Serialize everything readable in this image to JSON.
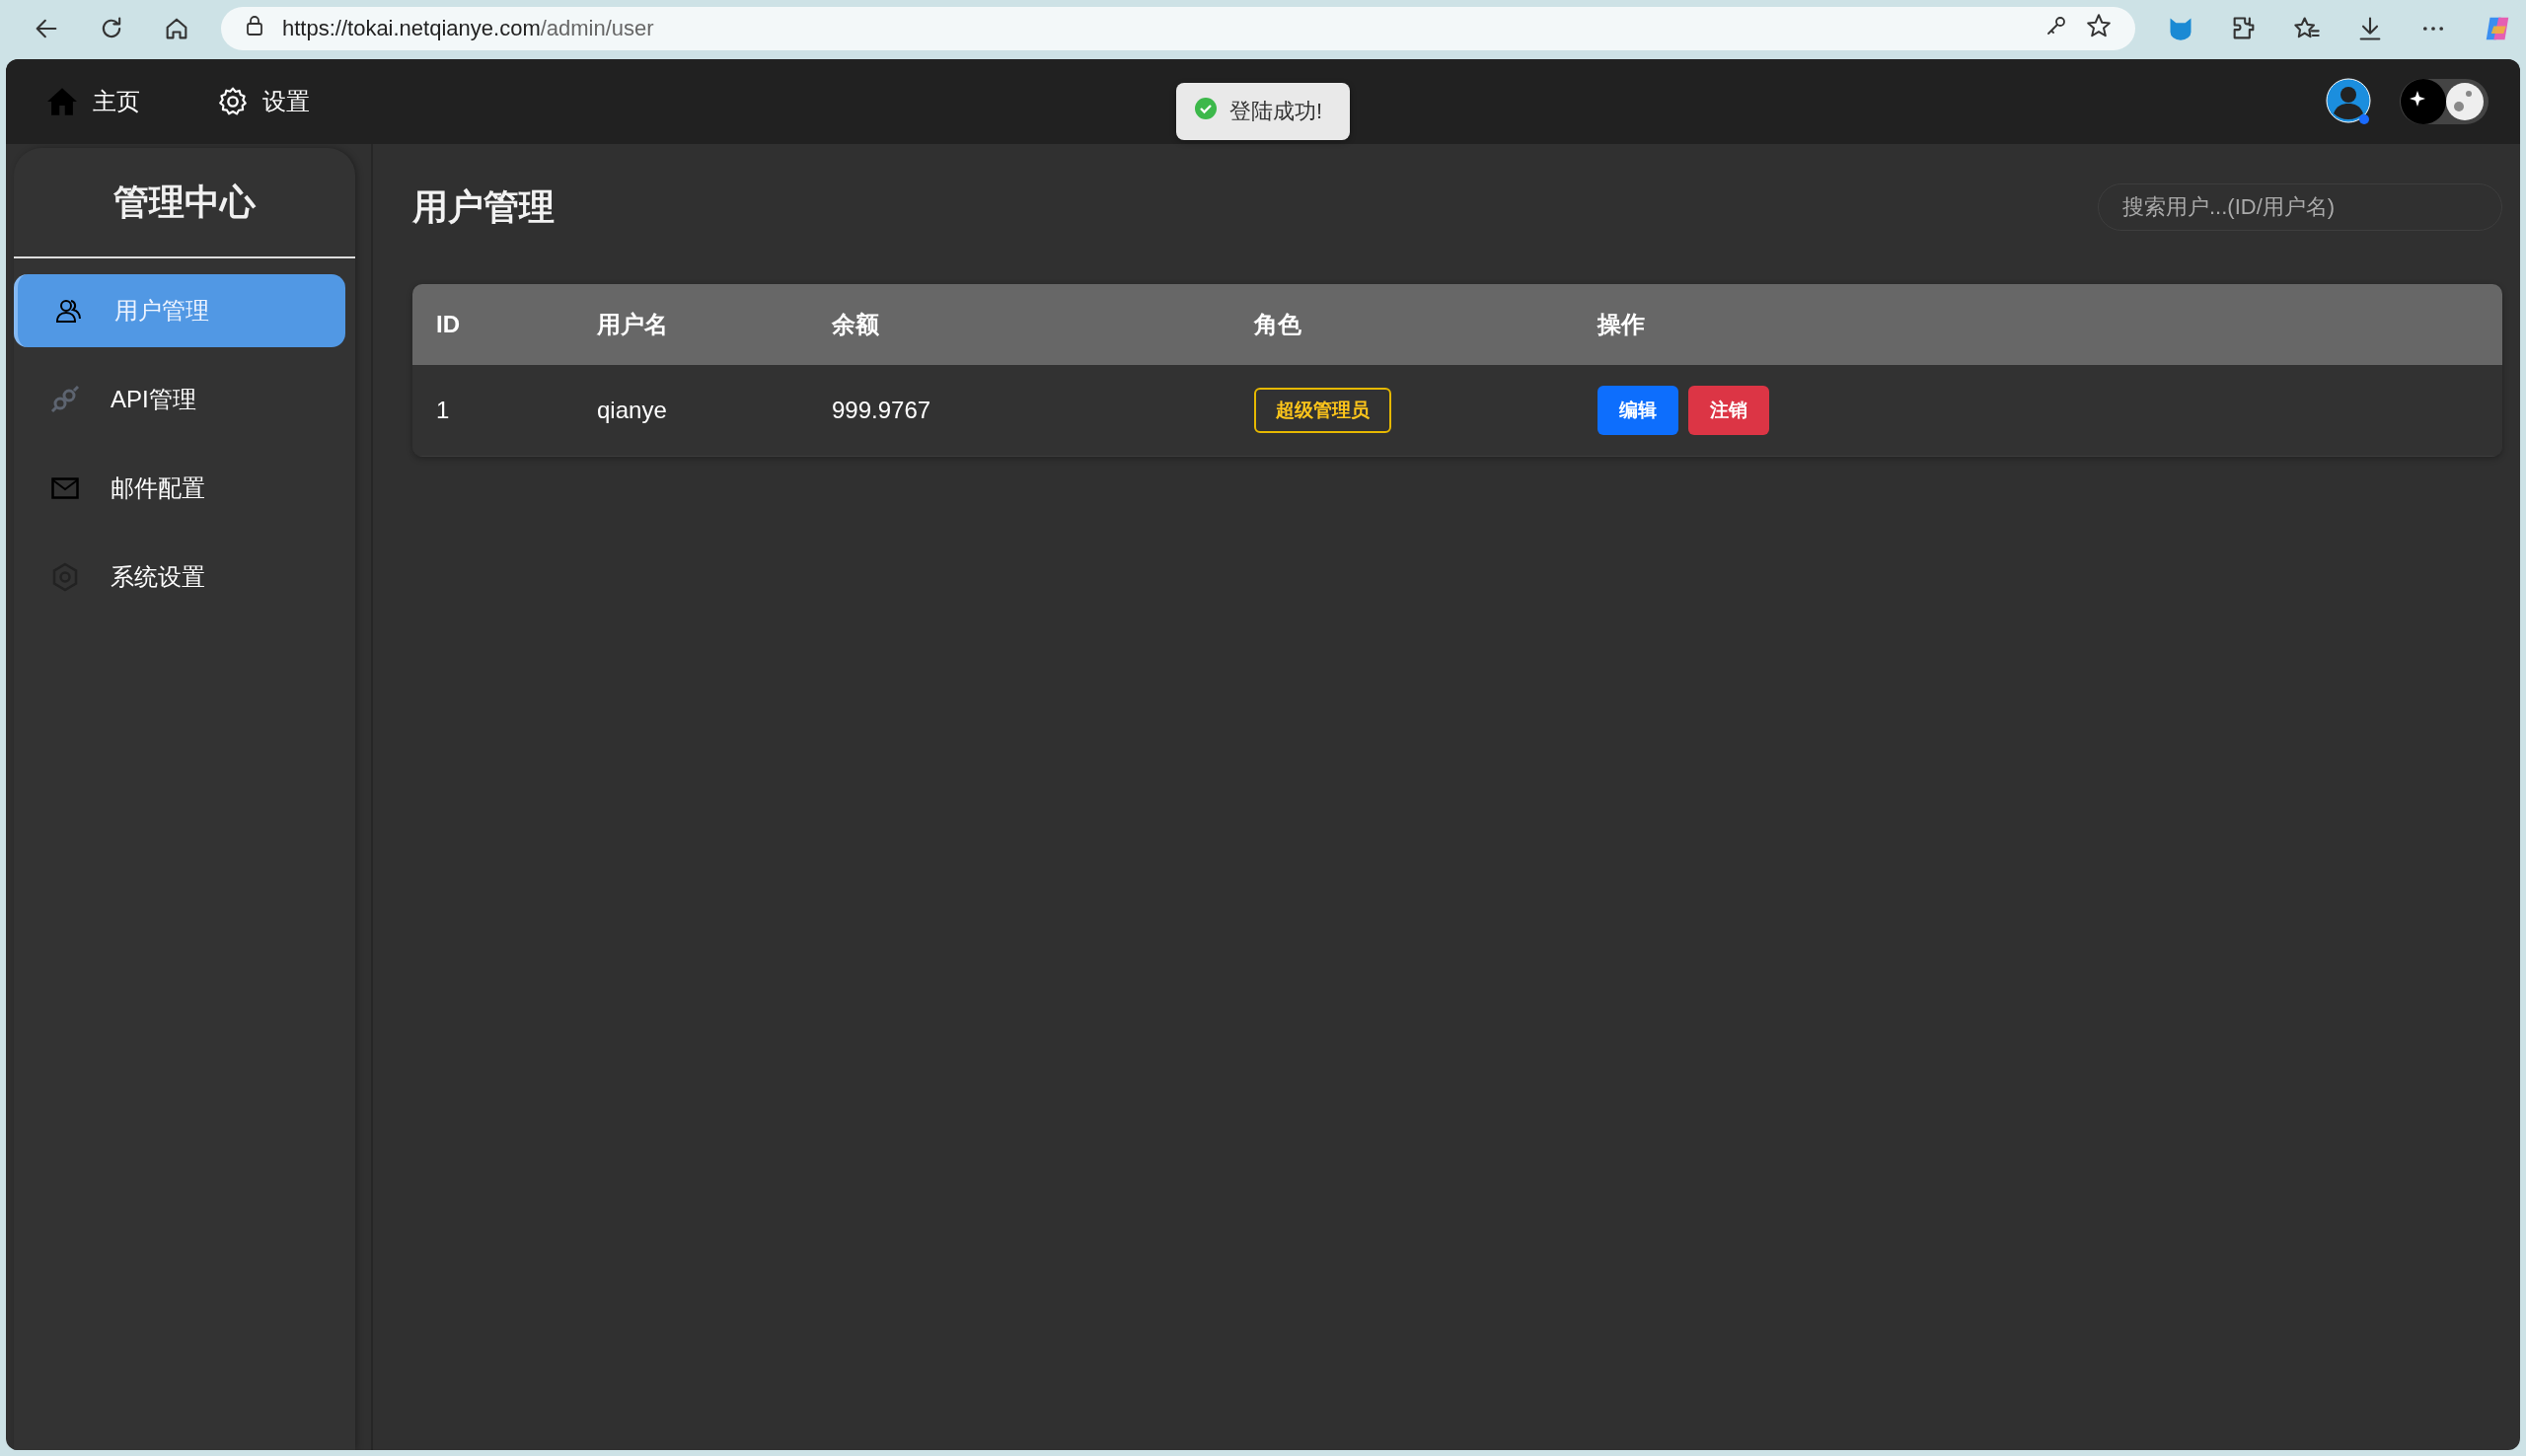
{
  "browser": {
    "url_host": "https://tokai.netqianye.com",
    "url_path": "/admin/user"
  },
  "top_nav": [
    {
      "kind": "home",
      "label": "主页"
    },
    {
      "kind": "settings",
      "label": "设置"
    }
  ],
  "toast": {
    "kind": "success",
    "message": "登陆成功!"
  },
  "sidebar": {
    "title": "管理中心",
    "items": [
      {
        "kind": "users",
        "label": "用户管理",
        "selected": true
      },
      {
        "kind": "plug",
        "label": "API管理",
        "selected": false
      },
      {
        "kind": "mail",
        "label": "邮件配置",
        "selected": false
      },
      {
        "kind": "gear",
        "label": "系统设置",
        "selected": false
      }
    ]
  },
  "page_title": "用户管理",
  "search": {
    "placeholder": "搜索用户...(ID/用户名)"
  },
  "table": {
    "columns": [
      "ID",
      "用户名",
      "余额",
      "角色",
      "操作"
    ],
    "rows": [
      {
        "id": "1",
        "username": "qianye",
        "balance": "999.9767",
        "role": "超级管理员",
        "actions": [
          {
            "kind": "edit",
            "label": "编辑"
          },
          {
            "kind": "delete",
            "label": "注销"
          }
        ]
      }
    ]
  }
}
